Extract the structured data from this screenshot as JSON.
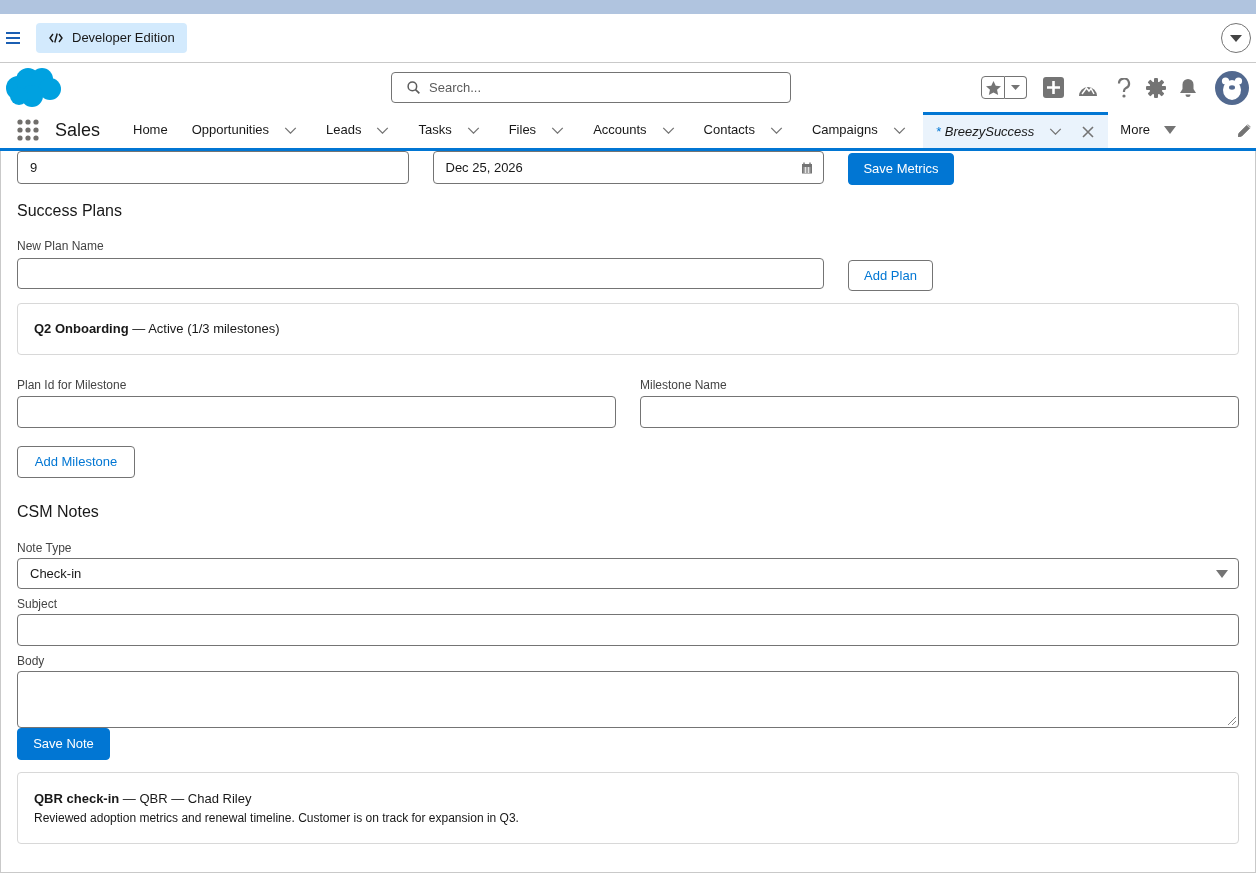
{
  "top_bar": {
    "edition_badge": "Developer Edition"
  },
  "header": {
    "search": {
      "placeholder": "Search..."
    }
  },
  "nav": {
    "app_name": "Sales",
    "items": [
      {
        "label": "Home",
        "menu": false,
        "selected": false,
        "temporary": false,
        "closable": false
      },
      {
        "label": "Opportunities",
        "menu": true,
        "selected": false,
        "temporary": false,
        "closable": false
      },
      {
        "label": "Leads",
        "menu": true,
        "selected": false,
        "temporary": false,
        "closable": false
      },
      {
        "label": "Tasks",
        "menu": true,
        "selected": false,
        "temporary": false,
        "closable": false
      },
      {
        "label": "Files",
        "menu": true,
        "selected": false,
        "temporary": false,
        "closable": false
      },
      {
        "label": "Accounts",
        "menu": true,
        "selected": false,
        "temporary": false,
        "closable": false
      },
      {
        "label": "Contacts",
        "menu": true,
        "selected": false,
        "temporary": false,
        "closable": false
      },
      {
        "label": "Campaigns",
        "menu": true,
        "selected": false,
        "temporary": false,
        "closable": false
      },
      {
        "prefix": "*",
        "label": "BreezySuccess",
        "menu": true,
        "selected": true,
        "temporary": true,
        "closable": true
      }
    ],
    "more": "More"
  },
  "metrics": {
    "fields": [
      {
        "kind": "number",
        "value": "9"
      },
      {
        "kind": "date",
        "value": "Dec 25, 2026"
      }
    ],
    "save_button": {
      "label": "Save Metrics",
      "kind": "brand"
    }
  },
  "success_plans": {
    "heading": "Success Plans",
    "new_plan_field": {
      "kind": "text",
      "label": "New Plan Name"
    },
    "add_plan_button": {
      "label": "Add Plan",
      "kind": "neutral"
    },
    "plans": [
      {
        "summary": "**Q2 Onboarding** — Active (1/3 milestones)"
      }
    ],
    "milestone_fields": [
      {
        "kind": "text",
        "label": "Plan Id for Milestone"
      },
      {
        "kind": "text",
        "label": "Milestone Name"
      }
    ],
    "add_milestone_button": {
      "label": "Add Milestone",
      "kind": "neutral"
    }
  },
  "csm_notes": {
    "heading": "CSM Notes",
    "fields": [
      {
        "kind": "select",
        "label": "Note Type",
        "value": "Check-in"
      },
      {
        "kind": "text",
        "label": "Subject"
      },
      {
        "kind": "textarea",
        "label": "Body"
      }
    ],
    "save_button": {
      "label": "Save Note",
      "kind": "brand"
    },
    "notes": [
      {
        "title": "**QBR check-in** — QBR — Chad Riley",
        "body": "Reviewed adoption metrics and renewal timeline. Customer is on track for expansion in Q3."
      }
    ]
  }
}
